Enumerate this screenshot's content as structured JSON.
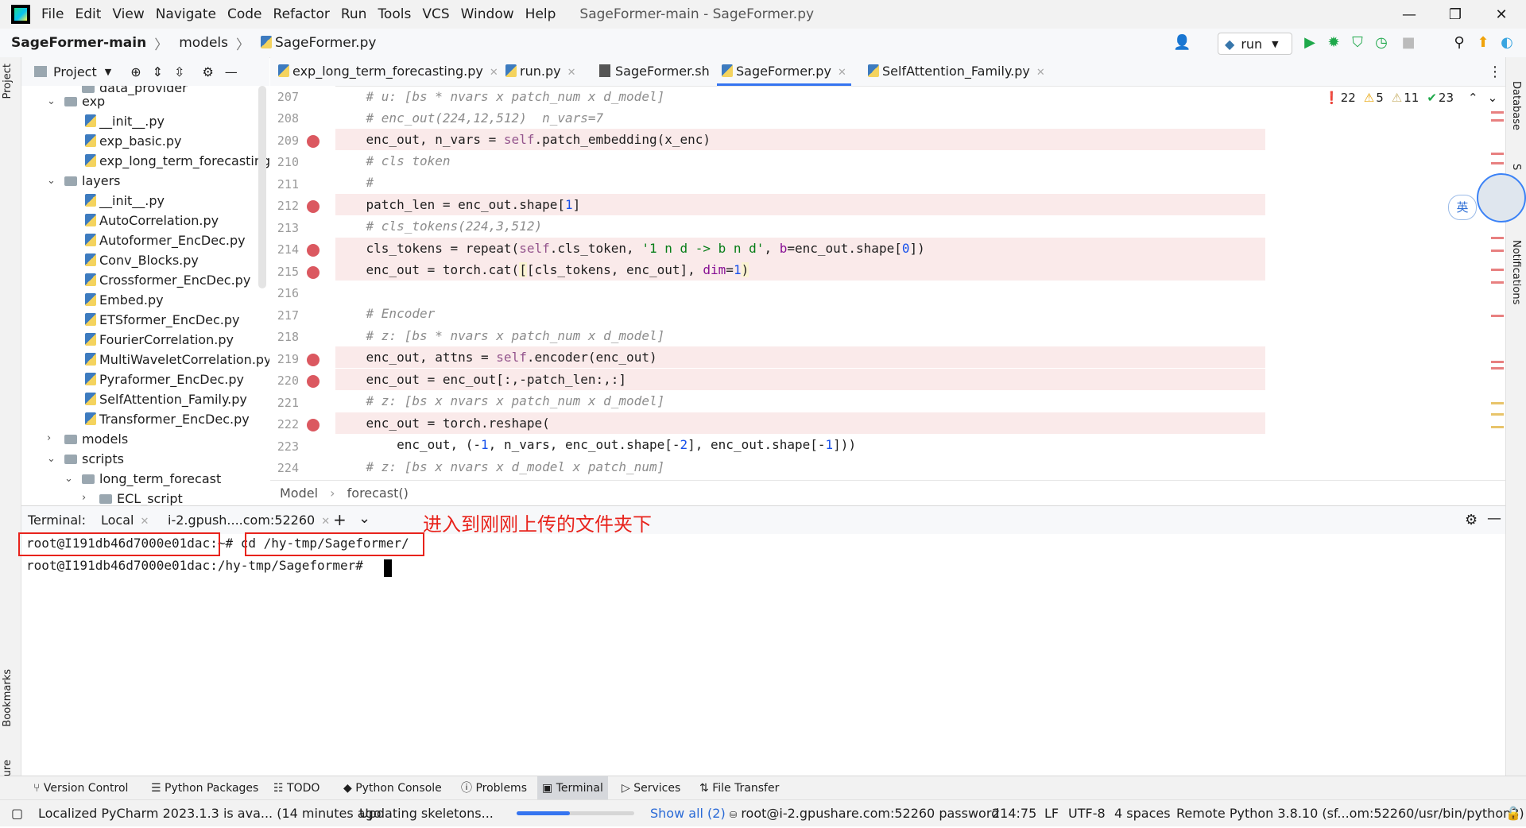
{
  "menu": [
    "File",
    "Edit",
    "View",
    "Navigate",
    "Code",
    "Refactor",
    "Run",
    "Tools",
    "VCS",
    "Window",
    "Help"
  ],
  "window_title": "SageFormer-main - SageFormer.py",
  "breadcrumb": {
    "project": "SageFormer-main",
    "folder": "models",
    "file": "SageFormer.py"
  },
  "run_config": "run",
  "left_strip": {
    "project": "Project",
    "bookmarks": "Bookmarks",
    "structure": "Structure"
  },
  "right_strip": {
    "database": "Database",
    "sciview": "S",
    "notifications": "Notifications"
  },
  "project_panel": {
    "title": "Project"
  },
  "tree": [
    {
      "label": "data_provider",
      "type": "folder"
    },
    {
      "label": "exp",
      "type": "folder"
    },
    {
      "label": "__init__.py",
      "type": "file"
    },
    {
      "label": "exp_basic.py",
      "type": "file"
    },
    {
      "label": "exp_long_term_forecasting.p",
      "type": "file"
    },
    {
      "label": "layers",
      "type": "folder"
    },
    {
      "label": "__init__.py",
      "type": "file"
    },
    {
      "label": "AutoCorrelation.py",
      "type": "file"
    },
    {
      "label": "Autoformer_EncDec.py",
      "type": "file"
    },
    {
      "label": "Conv_Blocks.py",
      "type": "file"
    },
    {
      "label": "Crossformer_EncDec.py",
      "type": "file"
    },
    {
      "label": "Embed.py",
      "type": "file"
    },
    {
      "label": "ETSformer_EncDec.py",
      "type": "file"
    },
    {
      "label": "FourierCorrelation.py",
      "type": "file"
    },
    {
      "label": "MultiWaveletCorrelation.py",
      "type": "file"
    },
    {
      "label": "Pyraformer_EncDec.py",
      "type": "file"
    },
    {
      "label": "SelfAttention_Family.py",
      "type": "file"
    },
    {
      "label": "Transformer_EncDec.py",
      "type": "file"
    },
    {
      "label": "models",
      "type": "folder"
    },
    {
      "label": "scripts",
      "type": "folder"
    },
    {
      "label": "long_term_forecast",
      "type": "folder"
    },
    {
      "label": "ECL_script",
      "type": "folder"
    }
  ],
  "editor_tabs": [
    "exp_long_term_forecasting.py",
    "run.py",
    "SageFormer.sh",
    "SageFormer.py",
    "SelfAttention_Family.py"
  ],
  "active_tab": "SageFormer.py",
  "line_numbers": [
    "207",
    "208",
    "209",
    "210",
    "211",
    "212",
    "213",
    "214",
    "215",
    "216",
    "217",
    "218",
    "219",
    "220",
    "221",
    "222",
    "223",
    "224"
  ],
  "inspections": {
    "errors": "22",
    "warnings": "5",
    "weak_warnings": "11",
    "ok": "23"
  },
  "editor_breadcrumb": {
    "class": "Model",
    "method": "forecast()"
  },
  "terminal": {
    "label": "Terminal:",
    "tabs": [
      "Local",
      "i-2.gpush....com:52260"
    ],
    "prompt1": "root@I191db46d7000e01dac",
    "prompt1_suffix": ":~#",
    "command": "cd /hy-tmp/Sageformer",
    "command_tail": "/",
    "line2": "root@I191db46d7000e01dac:/hy-tmp/Sageformer#",
    "annotation": "进入到刚刚上传的文件夹下"
  },
  "bottom_tools": [
    "Version Control",
    "Python Packages",
    "TODO",
    "Python Console",
    "Problems",
    "Terminal",
    "Services",
    "File Transfer"
  ],
  "status": {
    "message": "Localized PyCharm 2023.1.3 is ava... (14 minutes ago",
    "task": "Updating skeletons...",
    "task_progress": 0.45,
    "show_all": "Show all (2)",
    "sftp": "root@i-2.gpushare.com:52260 password",
    "position": "214:75",
    "line_sep": "LF",
    "encoding": "UTF-8",
    "indent": "4 spaces",
    "interpreter": "Remote Python 3.8.10 (sf...om:52260/usr/bin/python3)"
  },
  "ime": "英"
}
